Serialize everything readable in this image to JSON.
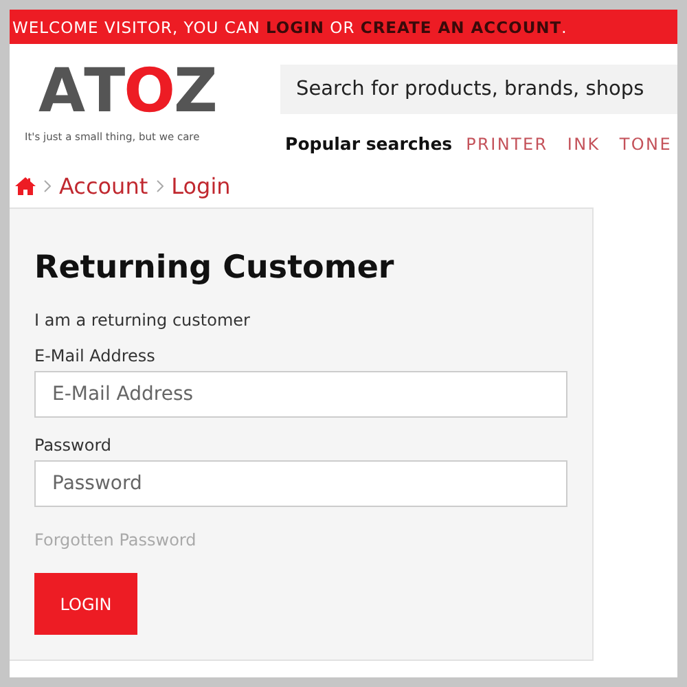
{
  "top_bar": {
    "text": "WELCOME VISITOR, YOU CAN ",
    "login_link": "LOGIN",
    "middle": " OR ",
    "create_link": "CREATE AN ACCOUNT",
    "end": "."
  },
  "logo": {
    "letters": [
      "A",
      "T",
      "O",
      "Z"
    ],
    "tagline": "It's just a small thing, but we care"
  },
  "search": {
    "placeholder": "Search for products, brands, shops"
  },
  "popular": {
    "label": "Popular searches",
    "items": [
      "PRINTER",
      "INK",
      "TONE"
    ]
  },
  "breadcrumb": [
    "Account",
    "Login"
  ],
  "form": {
    "title": "Returning Customer",
    "subtitle": "I am a returning customer",
    "fields": [
      {
        "label": "E-Mail Address",
        "placeholder": "E-Mail Address"
      },
      {
        "label": "Password",
        "placeholder": "Password"
      }
    ],
    "forgotten": "Forgotten Password",
    "button": "LOGIN"
  }
}
